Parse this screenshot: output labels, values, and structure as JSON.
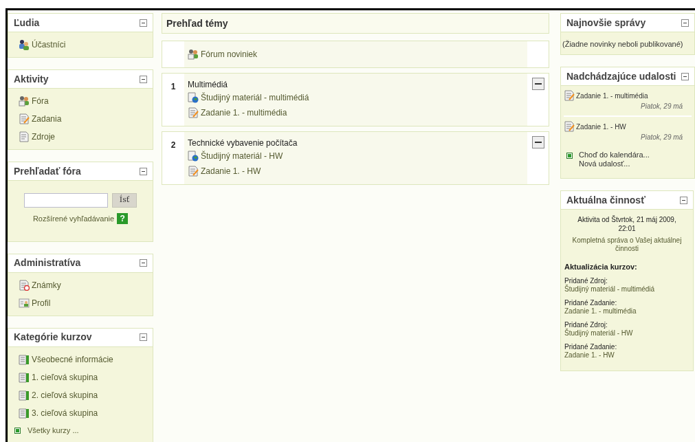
{
  "left_blocks": [
    {
      "kind": "list",
      "title": "Ľudia",
      "items": [
        {
          "label": "Účastníci",
          "kind": "people"
        }
      ]
    },
    {
      "kind": "list",
      "title": "Aktivity",
      "items": [
        {
          "label": "Fóra",
          "kind": "forum"
        },
        {
          "label": "Zadania",
          "kind": "assignment"
        },
        {
          "label": "Zdroje",
          "kind": "resource"
        }
      ]
    },
    {
      "kind": "search",
      "title": "Prehľadať fóra",
      "button": "Ísť",
      "link": "Rozšírené vyhľadávanie",
      "help": "?"
    },
    {
      "kind": "list",
      "title": "Administratíva",
      "items": [
        {
          "label": "Známky",
          "kind": "grades"
        },
        {
          "label": "Profil",
          "kind": "profile"
        }
      ]
    },
    {
      "kind": "list",
      "title": "Kategórie kurzov",
      "items": [
        {
          "label": "Všeobecné informácie",
          "kind": "category"
        },
        {
          "label": "1. cieľová skupina",
          "kind": "category"
        },
        {
          "label": "2. cieľová skupina",
          "kind": "category"
        },
        {
          "label": "3. cieľová skupina",
          "kind": "category"
        }
      ],
      "footer_link": "Všetky kurzy ..."
    }
  ],
  "outline": {
    "title": "Prehľad témy",
    "sections": [
      {
        "items": [
          {
            "label": "Fórum noviniek",
            "kind": "forum"
          }
        ]
      },
      {
        "number": "1",
        "title": "Multimédiá",
        "collapsible": true,
        "items": [
          {
            "label": "Študijný materiál - multimédiá",
            "kind": "web"
          },
          {
            "label": "Zadanie 1. - multimédia",
            "kind": "assignment"
          }
        ]
      },
      {
        "number": "2",
        "title": "Technické vybavenie počítača",
        "collapsible": true,
        "items": [
          {
            "label": "Študijný materiál - HW",
            "kind": "web"
          },
          {
            "label": "Zadanie 1. - HW",
            "kind": "assignment"
          }
        ]
      }
    ]
  },
  "news": {
    "title": "Najnovšie správy",
    "text": "(Žiadne novinky neboli publikované)"
  },
  "events": {
    "title": "Nadchádzajúce udalosti",
    "items": [
      {
        "label": "Zadanie 1. - multimédia",
        "date": "Piatok, 29 má"
      },
      {
        "label": "Zadanie 1. - HW",
        "date": "Piatok, 29 má"
      }
    ],
    "links": [
      "Choď do kalendára...",
      "Nová udalosť..."
    ]
  },
  "activity": {
    "title": "Aktuálna činnosť",
    "since": "Aktivita od Štvrtok, 21 máj 2009, 22:01",
    "report_link": "Kompletná správa o Vašej aktuálnej činnosti",
    "heading": "Aktualizácia kurzov:",
    "updates": [
      {
        "label": "Pridané Zdroj:",
        "link": "Študijný materiál - multimédiá"
      },
      {
        "label": "Pridané Zadanie:",
        "link": "Zadanie 1. - multimédia"
      },
      {
        "label": "Pridané Zdroj:",
        "link": "Študijný materiál - HW"
      },
      {
        "label": "Pridané Zadanie:",
        "link": "Zadanie 1. - HW"
      }
    ]
  }
}
